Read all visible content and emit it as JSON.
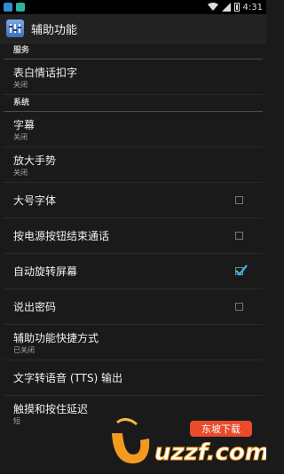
{
  "header": {
    "title": "辅助功能"
  },
  "status": {
    "time": "4:31"
  },
  "sections": {
    "services": "服务",
    "system": "系统"
  },
  "items": {
    "talkback": {
      "title": "表白情话扣字",
      "sub": "关闭"
    },
    "captions": {
      "title": "字幕",
      "sub": "关闭"
    },
    "magnify": {
      "title": "放大手势",
      "sub": "关闭"
    },
    "large_text": {
      "title": "大号字体",
      "checked": false
    },
    "power_end_call": {
      "title": "按电源按钮结束通话",
      "checked": false
    },
    "auto_rotate": {
      "title": "自动旋转屏幕",
      "checked": true
    },
    "speak_password": {
      "title": "说出密码",
      "checked": false
    },
    "shortcut": {
      "title": "辅助功能快捷方式",
      "sub": "已关闭"
    },
    "tts": {
      "title": "文字转语音 (TTS) 输出"
    },
    "touch_delay": {
      "title": "触摸和按住延迟",
      "sub": "短"
    }
  },
  "watermark": {
    "text": "uzzf.com",
    "tag": "东坡下载"
  },
  "colors": {
    "accent": "#33b5e5",
    "background": "#1a1a1a"
  }
}
